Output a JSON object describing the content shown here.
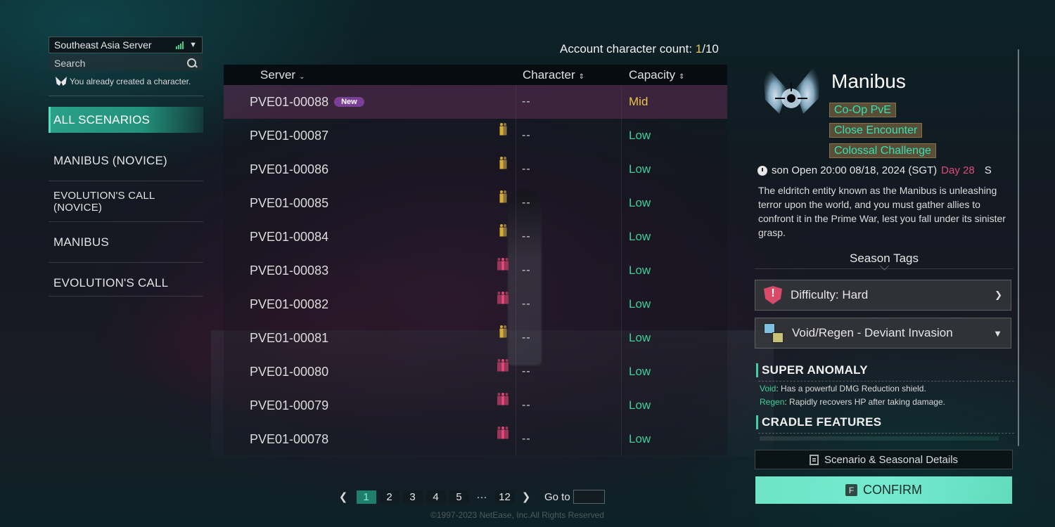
{
  "server_selector": {
    "label": "Southeast Asia Server",
    "signal_icon": "signal-bars-icon",
    "dropdown_icon": "chevron-down-icon"
  },
  "search": {
    "placeholder": "Search",
    "value": ""
  },
  "created_note": "You already created a character.",
  "scenarios": [
    {
      "label": "ALL SCENARIOS",
      "active": true
    },
    {
      "label": "MANIBUS (NOVICE)",
      "active": false
    },
    {
      "label": "EVOLUTION'S CALL (NOVICE)",
      "active": false
    },
    {
      "label": "MANIBUS",
      "active": false
    },
    {
      "label": "EVOLUTION'S CALL",
      "active": false
    }
  ],
  "account": {
    "label": "Account character count: ",
    "current": "1",
    "max": "/10"
  },
  "table": {
    "columns": {
      "server": "Server",
      "character": "Character",
      "capacity": "Capacity"
    },
    "rows": [
      {
        "server": "PVE01-00088",
        "badge": "New",
        "load": "none",
        "character": "--",
        "capacity": "Mid",
        "selected": true
      },
      {
        "server": "PVE01-00087",
        "badge": "",
        "load": "gold",
        "character": "--",
        "capacity": "Low"
      },
      {
        "server": "PVE01-00086",
        "badge": "",
        "load": "gold",
        "character": "--",
        "capacity": "Low"
      },
      {
        "server": "PVE01-00085",
        "badge": "",
        "load": "gold",
        "character": "--",
        "capacity": "Low"
      },
      {
        "server": "PVE01-00084",
        "badge": "",
        "load": "gold",
        "character": "--",
        "capacity": "Low"
      },
      {
        "server": "PVE01-00083",
        "badge": "",
        "load": "pink",
        "character": "--",
        "capacity": "Low"
      },
      {
        "server": "PVE01-00082",
        "badge": "",
        "load": "pink",
        "character": "--",
        "capacity": "Low"
      },
      {
        "server": "PVE01-00081",
        "badge": "",
        "load": "gold",
        "character": "--",
        "capacity": "Low"
      },
      {
        "server": "PVE01-00080",
        "badge": "",
        "load": "pink",
        "character": "--",
        "capacity": "Low"
      },
      {
        "server": "PVE01-00079",
        "badge": "",
        "load": "pink",
        "character": "--",
        "capacity": "Low"
      },
      {
        "server": "PVE01-00078",
        "badge": "",
        "load": "pink",
        "character": "--",
        "capacity": "Low"
      }
    ]
  },
  "pagination": {
    "pages": [
      "1",
      "2",
      "3",
      "4",
      "5"
    ],
    "ellipsis": "···",
    "last": "12",
    "current": "1",
    "goto_label": "Go to",
    "goto_value": ""
  },
  "copyright": "©1997-2023 NetEase, Inc.All Rights Reserved",
  "detail": {
    "title": "Manibus",
    "tags": [
      "Co-Op PvE",
      "Close Encounter",
      "Colossal Challenge"
    ],
    "season_open": "son Open 20:00 08/18, 2024 (SGT)",
    "day": "Day 28",
    "trailing": "S",
    "description": "The eldritch entity known as the Manibus is unleashing terror upon the world, and you must gather allies to confront it in the Prime War, lest you fall under its sinister grasp.",
    "season_tags_label": "Season Tags",
    "difficulty": "Difficulty: Hard",
    "anomaly_tag": "Void/Regen - Deviant Invasion",
    "super_anomaly": {
      "heading": "SUPER ANOMALY",
      "items": [
        {
          "key": "Void",
          "text": ": Has a powerful DMG Reduction shield."
        },
        {
          "key": "Regen",
          "text": ": Rapidly recovers HP after taking damage."
        }
      ]
    },
    "cradle_heading": "CRADLE FEATURES",
    "details_button": "Scenario & Seasonal Details",
    "confirm_key": "F",
    "confirm_label": "CONFIRM"
  },
  "colors": {
    "accent": "#2aa088",
    "low": "#3fcf9a",
    "mid": "#e7c34a",
    "day": "#e24a78",
    "new_badge": "#7a3f96",
    "confirm": "#6de4c4"
  }
}
